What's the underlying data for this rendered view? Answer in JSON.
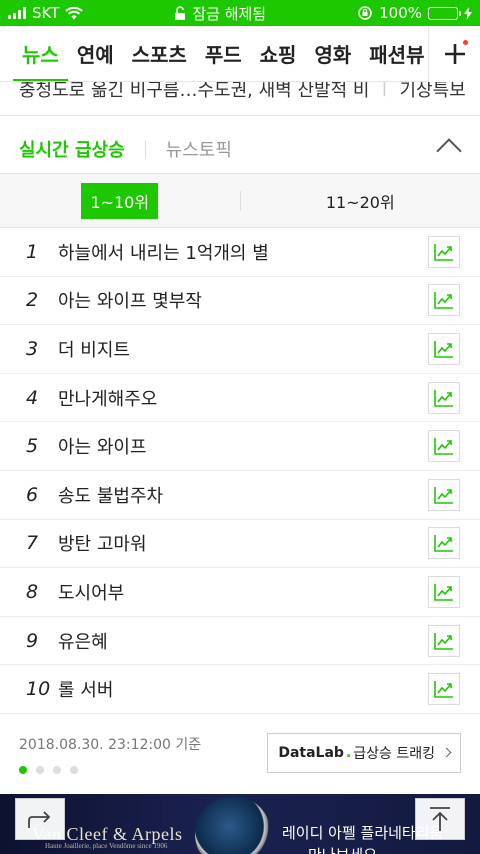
{
  "status_bar": {
    "carrier": "SKT",
    "center_text": "잠금 해제됨",
    "battery": "100%"
  },
  "tabs": [
    "뉴스",
    "연예",
    "스포츠",
    "푸드",
    "쇼핑",
    "영화",
    "패션뷰"
  ],
  "ticker": {
    "headline": "충청도로 옮긴 비구름…수도권, 새벽 산발적 비",
    "weather": "기상특보"
  },
  "ranking": {
    "tab_active": "실시간 급상승",
    "tab_inactive": "뉴스토픽",
    "range_active": "1~10위",
    "range_inactive": "11~20위",
    "items": [
      {
        "rank": "1",
        "text": "하늘에서 내리는 1억개의 별"
      },
      {
        "rank": "2",
        "text": "아는 와이프 몇부작"
      },
      {
        "rank": "3",
        "text": "더 비지트"
      },
      {
        "rank": "4",
        "text": "만나게해주오"
      },
      {
        "rank": "5",
        "text": "아는 와이프"
      },
      {
        "rank": "6",
        "text": "송도 불법주차"
      },
      {
        "rank": "7",
        "text": "방탄 고마워"
      },
      {
        "rank": "8",
        "text": "도시어부"
      },
      {
        "rank": "9",
        "text": "유은혜"
      },
      {
        "rank": "10",
        "text": "롤 서버"
      }
    ]
  },
  "footer": {
    "timestamp": "2018.08.30. 23:12:00 기준",
    "datalab_brand": "DataLab",
    "datalab_label": "급상승 트래킹"
  },
  "ad": {
    "brand": "Van Cleef & Arpels",
    "sub": "Haute Joaillerie, place Vendôme since 1906",
    "line1": "레이디 아펠 플라네타리움",
    "line2": "만나보세요"
  },
  "colors": {
    "accent": "#1ec800",
    "ad_bg": "#131a3f"
  }
}
